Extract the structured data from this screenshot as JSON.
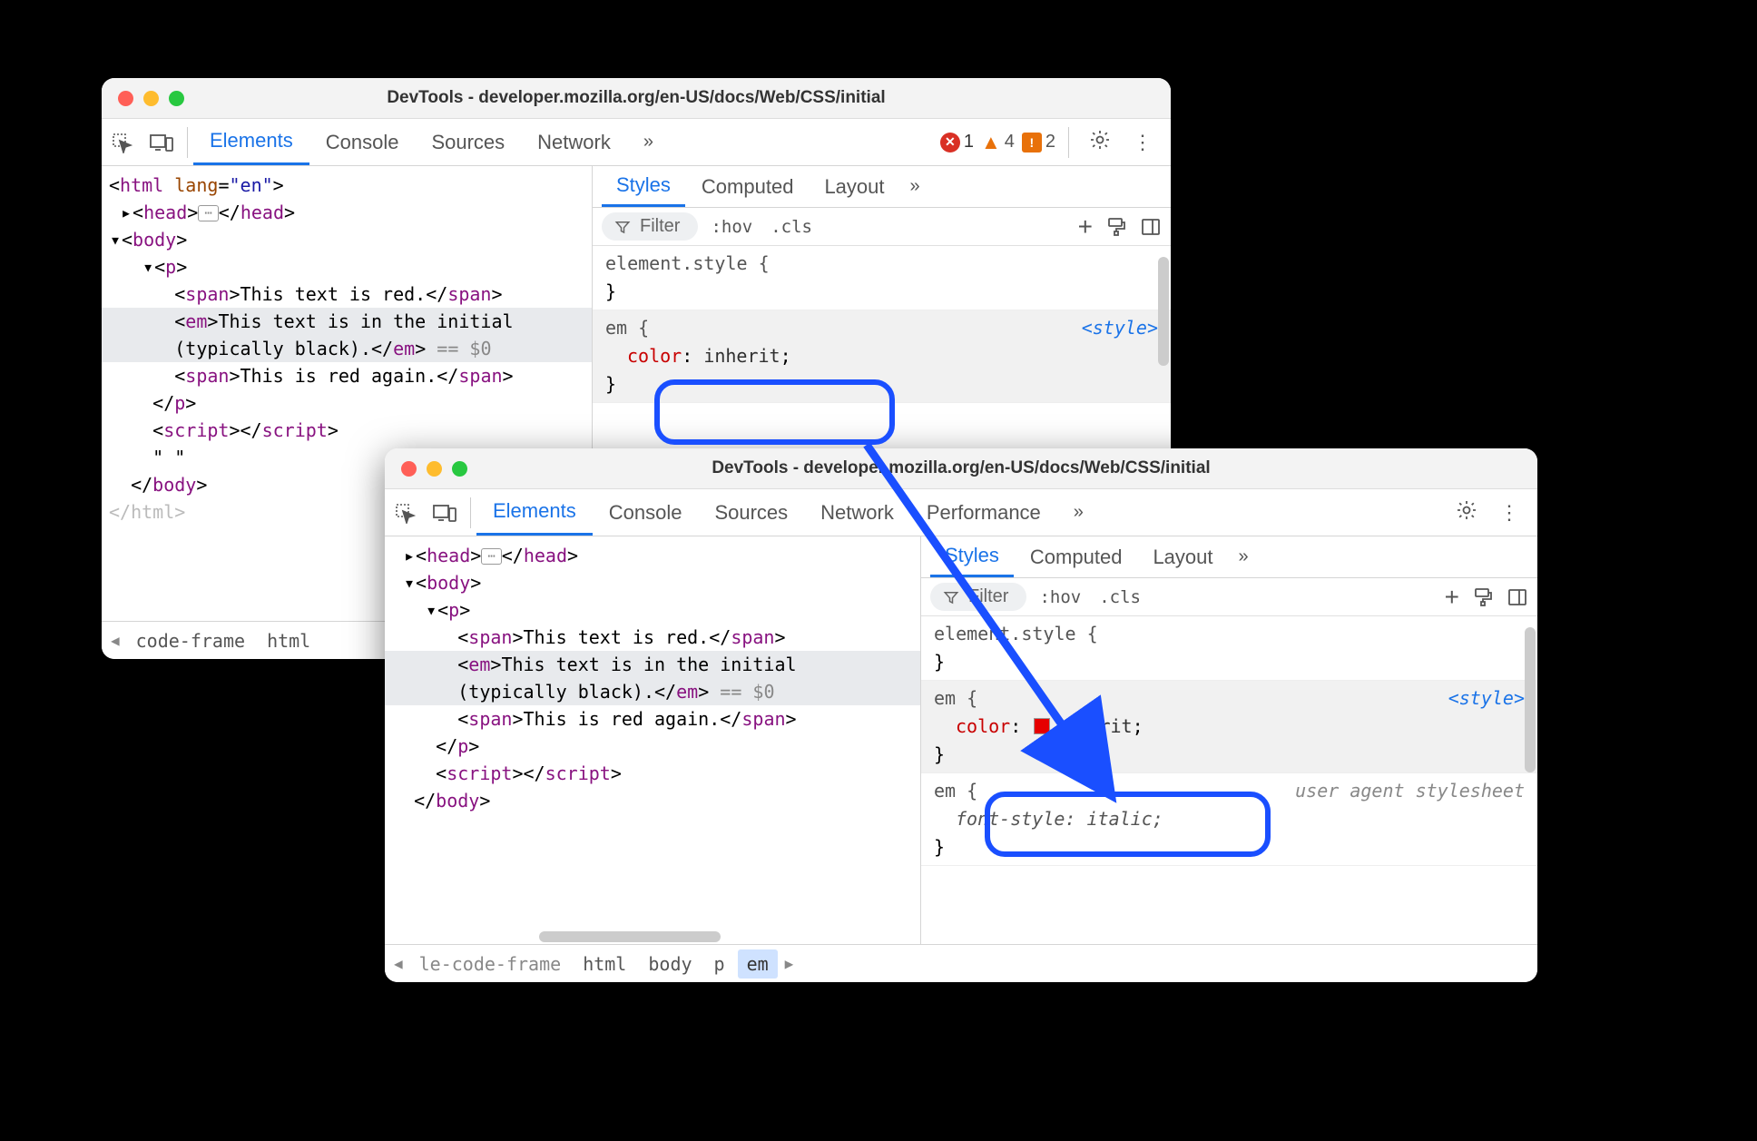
{
  "win1": {
    "title": "DevTools - developer.mozilla.org/en-US/docs/Web/CSS/initial",
    "tabs": {
      "elements": "Elements",
      "console": "Console",
      "sources": "Sources",
      "network": "Network"
    },
    "more": "»",
    "badges": {
      "err": "1",
      "warn": "4",
      "issue": "2"
    },
    "bc": {
      "left": "code-frame",
      "html": "html"
    },
    "sp": {
      "styles": "Styles",
      "computed": "Computed",
      "layout": "Layout",
      "more": "»",
      "filter": "Filter",
      "hov": ":hov",
      "cls": ".cls"
    },
    "rule0": {
      "sel_open": "element.style {",
      "close": "}"
    },
    "rule1": {
      "sel_open": "em {",
      "origin": "<style>",
      "prop_n": "color",
      "colon": ": ",
      "prop_v": "inherit",
      "semi": ";",
      "close": "}"
    },
    "dom": {
      "html_open": "html",
      "lang_attr": "lang",
      "lang_val": "\"en\"",
      "head": "head",
      "body": "body",
      "p": "p",
      "span": "span",
      "em": "em",
      "script": "script",
      "txt_red": "This text is red.",
      "txt_init": "This text is in the initial",
      "txt_init2": "(typically black).",
      "txt_again": "This is red again.",
      "eq0": " == $0",
      "quote": "\" \""
    }
  },
  "win2": {
    "title": "DevTools - developer.mozilla.org/en-US/docs/Web/CSS/initial",
    "tabs": {
      "elements": "Elements",
      "console": "Console",
      "sources": "Sources",
      "network": "Network",
      "performance": "Performance"
    },
    "more": "»",
    "bc": {
      "pre": "le-code-frame",
      "html": "html",
      "body": "body",
      "p": "p",
      "em": "em"
    },
    "sp": {
      "styles": "Styles",
      "computed": "Computed",
      "layout": "Layout",
      "more": "»",
      "filter": "Filter",
      "hov": ":hov",
      "cls": ".cls"
    },
    "rule0": {
      "sel_open": "element.style {",
      "close": "}"
    },
    "rule1": {
      "sel_open": "em {",
      "origin": "<style>",
      "prop_n": "color",
      "colon": ": ",
      "prop_v": "inherit",
      "semi": ";",
      "close": "}"
    },
    "rule2": {
      "sel_open": "em {",
      "origin": "user agent stylesheet",
      "prop_n": "font-style",
      "colon": ": ",
      "prop_v": "italic",
      "semi": ";",
      "close": "}"
    },
    "dom": {
      "head": "head",
      "body": "body",
      "p": "p",
      "span": "span",
      "em": "em",
      "script": "script",
      "txt_red": "This text is red.",
      "txt_init": "This text is in the initial",
      "txt_init2": "(typically black).",
      "txt_again": "This is red again.",
      "eq0": " == $0"
    }
  }
}
